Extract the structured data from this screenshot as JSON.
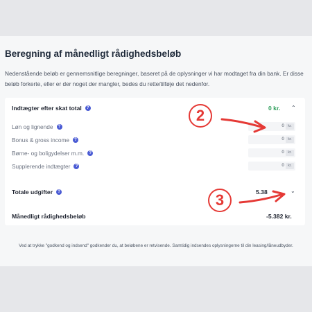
{
  "page": {
    "title": "Beregning af månedligt rådighedsbeløb",
    "intro": "Nedenstående beløb er gennemsnitlige beregninger, baseret på de oplysninger vi har modtaget fra din bank. Er disse beløb forkerte, eller er der noget der mangler, bedes du rette/tilføje det nedenfor.",
    "footnote": "Ved at trykke \"godkend og indsend\" godkender du, at beløbene er retvisende. Samtidig indsendes oplysningerne til din leasing/låneudbyder."
  },
  "income": {
    "label": "Indtægter efter skat total",
    "total": "0 kr.",
    "items": [
      {
        "label": "Løn og lignende",
        "value": "0",
        "unit": "kr."
      },
      {
        "label": "Bonus & gross income",
        "value": "0",
        "unit": "kr."
      },
      {
        "label": "Børne- og boligydelser m.m.",
        "value": "0",
        "unit": "kr."
      },
      {
        "label": "Supplerende indtægter",
        "value": "0",
        "unit": "kr."
      }
    ]
  },
  "expenses": {
    "label": "Totale udgifter",
    "total": "5.38"
  },
  "disposable": {
    "label": "Månedligt rådighedsbeløb",
    "total": "-5.382 kr."
  },
  "annotations": {
    "first": "2",
    "second": "3"
  },
  "colors": {
    "accent": "#4a5bd4",
    "positive": "#2e9e5b",
    "annotation": "#e53935"
  },
  "icons": {
    "help": "question-icon",
    "collapse": "chevron-up-icon",
    "expand": "chevron-down-icon"
  }
}
